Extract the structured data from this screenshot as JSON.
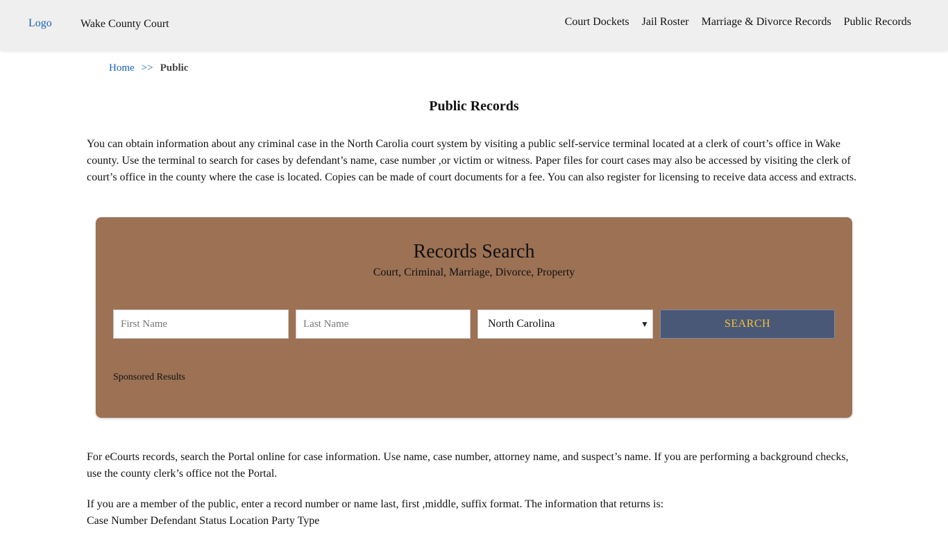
{
  "header": {
    "logo_alt": "Logo",
    "site_title": "Wake County Court",
    "nav": [
      "Court Dockets",
      "Jail Roster",
      "Marriage & Divorce Records",
      "Public Records"
    ]
  },
  "breadcrumb": {
    "home": "Home",
    "separator": ">>",
    "current": "Public"
  },
  "page_title": "Public Records",
  "intro": "You can obtain information about any criminal case in the North Carolia court system by visiting a public self-service terminal located at a clerk of court’s office in Wake county. Use the terminal to search for cases by defendant’s name, case number ,or victim or witness. Paper files for court cases may also be accessed by visiting the clerk of court’s office in the county where the case is located. Copies can be made of court documents for a fee. You can also register for licensing to receive data access and extracts.",
  "search": {
    "title": "Records Search",
    "subtitle": "Court, Criminal, Marriage, Divorce, Property",
    "first_name_placeholder": "First Name",
    "last_name_placeholder": "Last Name",
    "state_value": "North Carolina",
    "button_label": "SEARCH",
    "sponsored": "Sponsored Results",
    "box_color": "#9c7154",
    "button_color": "#4a5877",
    "button_text_color": "#f0c43b"
  },
  "para2": "For eCourts records, search the Portal online for case information. Use name, case number, attorney name, and suspect’s name. If you are performing a background checks, use the county clerk’s office not the Portal.",
  "para3_line1": "If you are a member of the public, enter a record number or name last, first ,middle, suffix format. The information that returns is:",
  "para3_line2": "Case Number Defendant Status Location Party Type"
}
